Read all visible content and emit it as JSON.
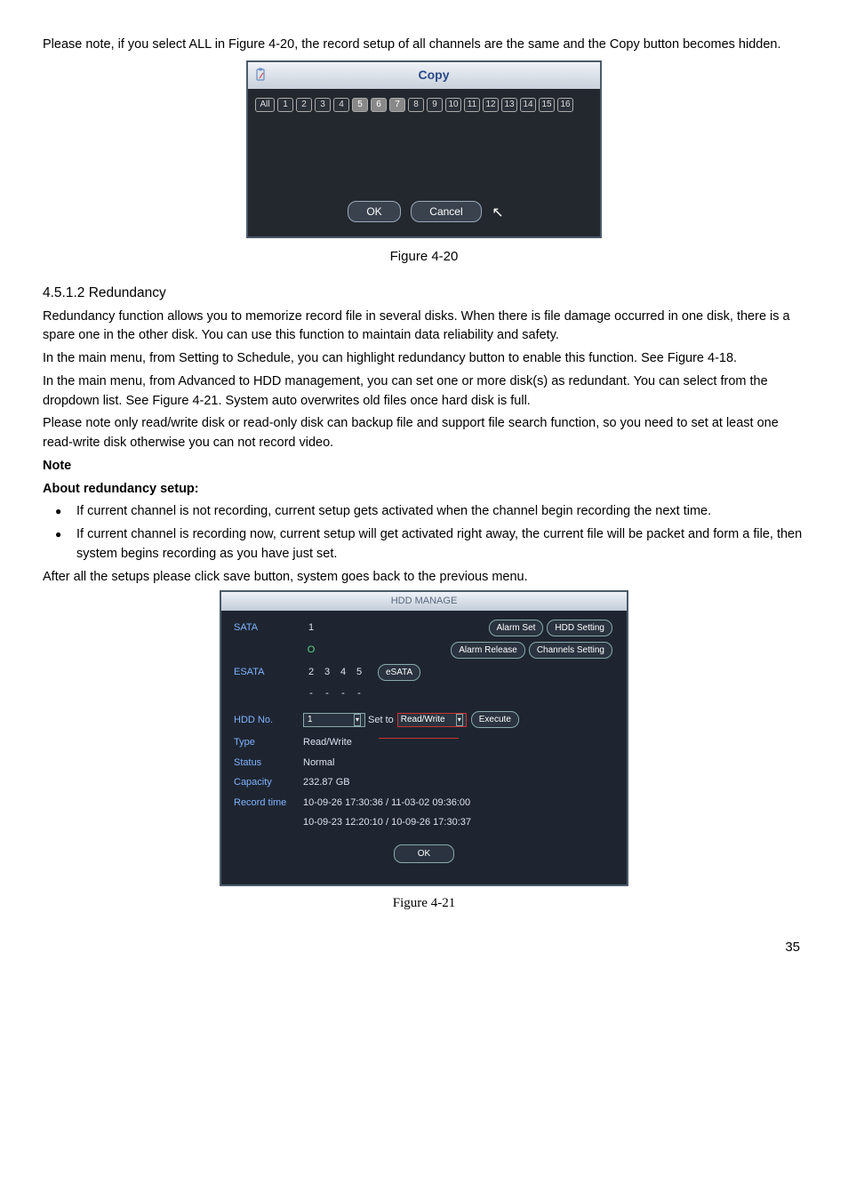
{
  "intro": {
    "p1": "Please note, if you select ALL in Figure 4-20, the record setup of all channels are the same and the Copy button becomes hidden."
  },
  "copy_dialog": {
    "title": "Copy",
    "all": "All",
    "channels": [
      "1",
      "2",
      "3",
      "4",
      "5",
      "6",
      "7",
      "8",
      "9",
      "10",
      "11",
      "12",
      "13",
      "14",
      "15",
      "16"
    ],
    "selected_indices": [
      4,
      5,
      6
    ],
    "ok": "OK",
    "cancel": "Cancel",
    "caption": "Figure 4-20"
  },
  "section": {
    "num": "4.5.1.2  Redundancy",
    "p1": "Redundancy function allows you to memorize record file in several disks. When there is file damage occurred in one disk, there is a spare one in the other disk. You can use this function to maintain data reliability and safety.",
    "p2": "In the main menu, from Setting to Schedule, you can highlight redundancy button to enable this function. See Figure 4-18.",
    "p3": "In the main menu, from Advanced to HDD management, you can set one or more disk(s) as redundant. You can select from the dropdown list. See Figure 4-21. System auto overwrites old files once hard disk is full.",
    "p4": "Please note only read/write disk or read-only disk can backup file and support file search function, so you need to set at least one read-write disk otherwise you can not record video.",
    "note": "Note",
    "about": "About redundancy setup:",
    "b1": "If current channel is not recording, current setup gets activated when the channel begin recording the next time.",
    "b2": "If current channel is recording now, current setup will get activated right away, the current file will be packet and form a file, then system begins recording as you have just set.",
    "p5": "After all the setups please click save button, system goes back to the previous menu."
  },
  "hdd_dialog": {
    "title": "HDD MANAGE",
    "sata_label": "SATA",
    "sata_num": "1",
    "sata_mark": "O",
    "alarm_set": "Alarm Set",
    "hdd_setting": "HDD Setting",
    "alarm_release": "Alarm Release",
    "channels_setting": "Channels Setting",
    "esata_label": "ESATA",
    "esata_nums": [
      "2",
      "3",
      "4",
      "5"
    ],
    "esata_btn": "eSATA",
    "hdd_no_label": "HDD No.",
    "hdd_no_value": "1",
    "set_to": "Set to",
    "set_to_value": "Read/Write",
    "execute": "Execute",
    "type_label": "Type",
    "type_value": "Read/Write",
    "status_label": "Status",
    "status_value": "Normal",
    "capacity_label": "Capacity",
    "capacity_value": "232.87 GB",
    "record_time_label": "Record time",
    "record_time_line1": "10-09-26 17:30:36 / 11-03-02 09:36:00",
    "record_time_line2": "10-09-23 12:20:10 / 10-09-26 17:30:37",
    "ok": "OK",
    "caption": "Figure 4-21"
  },
  "page_number": "35"
}
